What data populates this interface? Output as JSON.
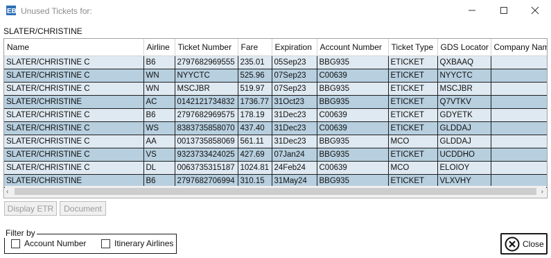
{
  "window": {
    "title": "Unused Tickets for:",
    "controls": {
      "minimize": "minimize",
      "maximize": "maximize",
      "close": "close"
    }
  },
  "passenger": "SLATER/CHRISTINE",
  "grid": {
    "columns": [
      "Name",
      "Airline",
      "Ticket Number",
      "Fare",
      "Expiration",
      "Account Number",
      "Ticket Type",
      "GDS Locator",
      "Company Nam"
    ],
    "rows": [
      [
        "SLATER/CHRISTINE C",
        "B6",
        "2797682969555",
        "235.01",
        "05Sep23",
        "BBG935",
        "ETICKET",
        "QXBAAQ",
        ""
      ],
      [
        "SLATER/CHRISTINE C",
        "WN",
        "NYYCTC",
        "525.96",
        "07Sep23",
        "C00639",
        "ETICKET",
        "NYYCTC",
        ""
      ],
      [
        "SLATER/CHRISTINE C",
        "WN",
        "MSCJBR",
        "519.97",
        "07Sep23",
        "BBG935",
        "ETICKET",
        "MSCJBR",
        ""
      ],
      [
        "SLATER/CHRISTINE",
        "AC",
        "0142121734832",
        "1736.77",
        "31Oct23",
        "BBG935",
        "ETICKET",
        "Q7VTKV",
        ""
      ],
      [
        "SLATER/CHRISTINE C",
        "B6",
        "2797682969575",
        "178.19",
        "31Dec23",
        "C00639",
        "ETICKET",
        "GDYETK",
        ""
      ],
      [
        "SLATER/CHRISTINE C",
        "WS",
        "8383735858070",
        "437.40",
        "31Dec23",
        "C00639",
        "ETICKET",
        "GLDDAJ",
        ""
      ],
      [
        "SLATER/CHRISTINE C",
        "AA",
        "0013735858069",
        "561.11",
        "31Dec23",
        "BBG935",
        "MCO",
        "GLDDAJ",
        ""
      ],
      [
        "SLATER/CHRISTINE C",
        "VS",
        "9323733424025",
        "427.69",
        "07Jan24",
        "BBG935",
        "ETICKET",
        "UCDDHO",
        ""
      ],
      [
        "SLATER/CHRISTINE C",
        "DL",
        "0063735315187",
        "1024.81",
        "24Feb24",
        "C00639",
        "MCO",
        "ELOIOY",
        ""
      ],
      [
        "SLATER/CHRISTINE",
        "B6",
        "2797682706994",
        "310.15",
        "31May24",
        "BBG935",
        "ETICKET",
        "VLXVHY",
        ""
      ]
    ]
  },
  "buttons": {
    "display_etr": "Display ETR",
    "document": "Document",
    "close": "Close"
  },
  "filter": {
    "legend": "Filter by",
    "account_number": "Account Number",
    "itinerary_airlines": "Itinerary Airlines"
  },
  "colors": {
    "row_light": "#dfe9f1",
    "row_dark": "#b7cfdf",
    "app_icon": "#2f6fb5"
  }
}
